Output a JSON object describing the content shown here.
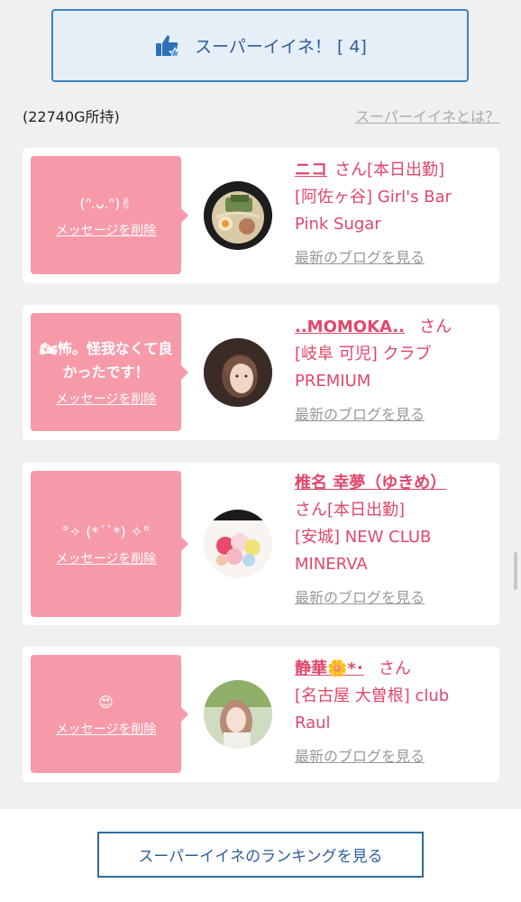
{
  "super_button": {
    "label": "スーパーイイネ！ [ 4]",
    "icon": "thumbs-up-star-icon"
  },
  "gold_text": "(22740G所持)",
  "what_is_link": "スーパーイイネとは？",
  "cards": [
    {
      "message": "(ᐢ.ᴗ.ᐢ)✌",
      "delete_label": "メッセージを削除",
      "name": "ニコ",
      "san": "さん",
      "status": "[本日出勤]",
      "shop_line1": "[阿佐ヶ谷] Girl's Bar",
      "shop_line2": "Pink Sugar",
      "blog_link": "最新のブログを見る"
    },
    {
      "message": "🏍怖。怪我なくて良かったです！",
      "delete_label": "メッセージを削除",
      "name": "..MOMOKA..",
      "san": "さん",
      "status": "",
      "shop_line1": "[岐阜 可児] クラブ",
      "shop_line2": "PREMIUM",
      "blog_link": "最新のブログを見る"
    },
    {
      "message": "°✧ (*´`*) ✧°",
      "delete_label": "メッセージを削除",
      "name": "椎名 幸夢（ゆきめ）",
      "san": "さん",
      "status": "[本日出勤]",
      "shop_line1": "[安城] NEW CLUB",
      "shop_line2": "MINERVA",
      "blog_link": "最新のブログを見る"
    },
    {
      "message": "😍",
      "delete_label": "メッセージを削除",
      "name": "静華🌼*･",
      "san": "さん",
      "status": "",
      "shop_line1": "[名古屋 大曽根] club",
      "shop_line2": "Raul",
      "blog_link": "最新のブログを見る"
    }
  ],
  "ranking_button": "スーパーイイネのランキングを見る"
}
